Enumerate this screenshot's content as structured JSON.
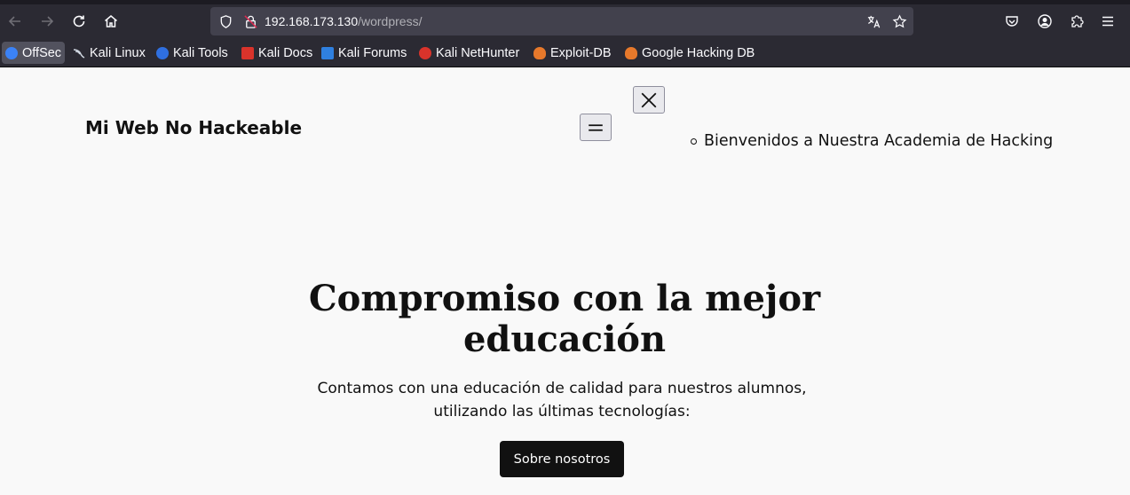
{
  "browser": {
    "url_host": "192.168.173.130",
    "url_path": "/wordpress/",
    "bookmarks": [
      {
        "label": "OffSec",
        "color": "#3b82f6"
      },
      {
        "label": "Kali Linux",
        "color": "#cfd6e0"
      },
      {
        "label": "Kali Tools",
        "color": "#2f6fe0"
      },
      {
        "label": "Kali Docs",
        "color": "#d9332b"
      },
      {
        "label": "Kali Forums",
        "color": "#2f80e0"
      },
      {
        "label": "Kali NetHunter",
        "color": "#d9332b"
      },
      {
        "label": "Exploit-DB",
        "color": "#e7792b"
      },
      {
        "label": "Google Hacking DB",
        "color": "#e7792b"
      }
    ]
  },
  "site": {
    "title": "Mi Web No Hackeable",
    "nav_items": [
      "Bienvenidos a Nuestra Academia de Hacking"
    ],
    "hero": {
      "heading": "Compromiso con la mejor educación",
      "text": "Contamos con una educación de calidad para nuestros alumnos, utilizando las últimas tecnologías:",
      "button": "Sobre nosotros"
    }
  }
}
